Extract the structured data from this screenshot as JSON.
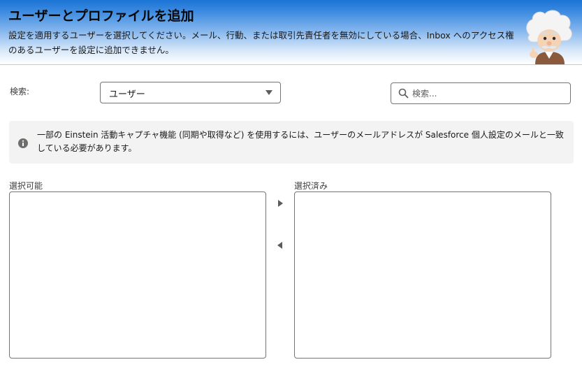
{
  "header": {
    "title": "ユーザーとプロファイルを追加",
    "description": "設定を適用するユーザーを選択してください。メール、行動、または取引先責任者を無効にしている場合、Inbox へのアクセス権のあるユーザーを設定に追加できません。"
  },
  "search": {
    "label": "検索:",
    "scope_selected": "ユーザー",
    "placeholder": "検索..."
  },
  "info": {
    "icon": "info-icon",
    "text": "一部の Einstein 活動キャプチャ機能 (同期や取得など) を使用するには、ユーザーのメールアドレスが Salesforce 個人設定のメールと一致している必要があります。"
  },
  "dual_list": {
    "available_label": "選択可能",
    "selected_label": "選択済み",
    "available_items": [],
    "selected_items": [],
    "move_right_icon": "triangle-right-icon",
    "move_left_icon": "triangle-left-icon"
  },
  "colors": {
    "header_gradient_top": "#1b73d4",
    "info_background": "#f3f3f3",
    "border": "#747474"
  }
}
